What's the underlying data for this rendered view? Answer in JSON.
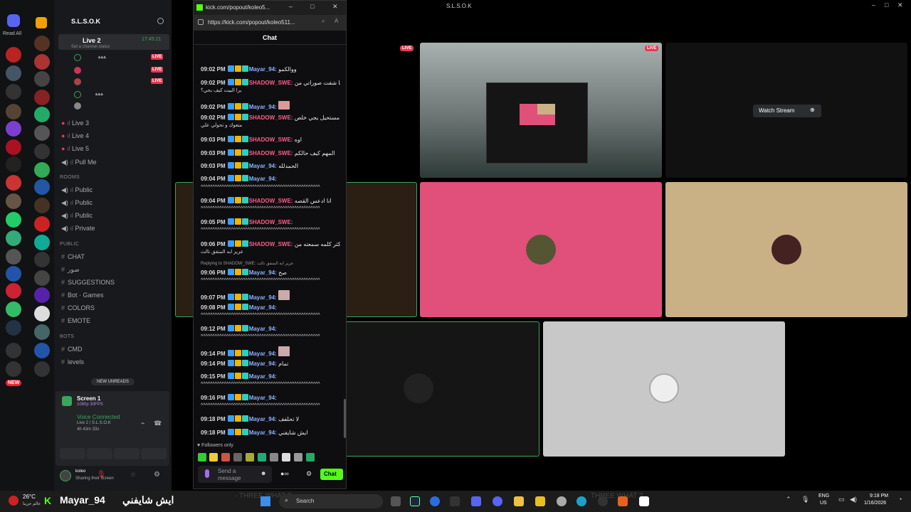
{
  "discord": {
    "read_all": "Read All",
    "new_label": "NEW",
    "server_name": "S.L.S.O.K",
    "live_channel": "Live 2",
    "live_time": "17:45:21",
    "set_status": "Set a channel status",
    "live_badge": "LIVE",
    "voice_users": [
      "ﻫﻫﻫ",
      "",
      "",
      "ﻫﻫﻫ",
      ""
    ],
    "channels_live": [
      "Live 3",
      "Live 4",
      "Live 5"
    ],
    "pull_me": "Pull Me",
    "rooms_label": "ROOMS",
    "rooms": [
      "Public",
      "Public",
      "Public",
      "Private"
    ],
    "public_label": "PUBLIC",
    "public_channels": [
      "CHAT",
      "صور",
      "SUGGESTIONS",
      "Bot · Games",
      "COLORS",
      "EMOTE"
    ],
    "bots_label": "BOTS",
    "bots_channels": [
      "CMD",
      "levels"
    ],
    "new_unreads": "NEW UNREADS",
    "screen_title": "Screen 1",
    "screen_sub": "1080p 30FPS",
    "voice_connected": "Voice Connected",
    "voice_channel": "Live 2 / S.L.S.O.K",
    "voice_time": "4h 43m 33s",
    "user_name": "koleo",
    "user_status": "Sharing their screen"
  },
  "window_title": "S.L.S.O.K",
  "stage": {
    "live_badge": "LIVE",
    "watch_stream": "Watch Stream"
  },
  "popout": {
    "title": "kick.com/popout/koleo5...",
    "url": "https://kick.com/popout/koleo511...",
    "header": "Chat",
    "messages": [
      {
        "time": "09:02 PM",
        "user": "Mayar_94:",
        "text": "ووالكمو"
      },
      {
        "time": "09:02 PM",
        "user": "SHADOW_SWE:",
        "text": "انا شفت صوراتي من"
      },
      {
        "time": "09:02 PM",
        "user": "Mayar_94:",
        "text": ""
      },
      {
        "time": "09:02 PM",
        "user": "SHADOW_SWE:",
        "text": "مستحيل يجي خلص"
      },
      {
        "time": "09:03 PM",
        "user": "SHADOW_SWE:",
        "text": "اوه"
      },
      {
        "time": "09:03 PM",
        "user": "SHADOW_SWE:",
        "text": "المهم كيف حالكم"
      },
      {
        "time": "09:03 PM",
        "user": "Mayar_94:",
        "text": "الحمدلله"
      },
      {
        "time": "09:04 PM",
        "user": "Mayar_94:",
        "text": ""
      },
      {
        "time": "09:04 PM",
        "user": "SHADOW_SWE:",
        "text": "انا ادعس القصه"
      },
      {
        "time": "09:05 PM",
        "user": "SHADOW_SWE:",
        "text": ""
      },
      {
        "time": "09:06 PM",
        "user": "SHADOW_SWE:",
        "text": "اكثر كلمه سمعته من"
      },
      {
        "time": "09:06 PM",
        "user": "Mayar_94:",
        "text": "صح"
      },
      {
        "time": "09:07 PM",
        "user": "Mayar_94:",
        "text": ""
      },
      {
        "time": "09:08 PM",
        "user": "Mayar_94:",
        "text": ""
      },
      {
        "time": "09:12 PM",
        "user": "Mayar_94:",
        "text": ""
      },
      {
        "time": "09:14 PM",
        "user": "Mayar_94:",
        "text": ""
      },
      {
        "time": "09:14 PM",
        "user": "Mayar_94:",
        "text": "تمام"
      },
      {
        "time": "09:15 PM",
        "user": "Mayar_94:",
        "text": ""
      },
      {
        "time": "09:16 PM",
        "user": "Mayar_94:",
        "text": ""
      },
      {
        "time": "09:18 PM",
        "user": "Mayar_94:",
        "text": "لا تحلفف"
      },
      {
        "time": "09:18 PM",
        "user": "Mayar_94:",
        "text": "ايش شايفني"
      }
    ],
    "continuation": "^^^^^^^^^^^^^^^^^^^^^^^^^^^^^^^^^^^^^^^^^^^^^^^^^^^",
    "line2_a": "برا البيت كيف بحي؟",
    "line2_b": "متعوك و تحولي علي",
    "line2_c": "عزيز ابه المتفق تالث",
    "reply_text": "Replying to SHADOW_SWE: عزيز ابه المتفق تالث",
    "followers_only": "Followers only",
    "send_placeholder": "Send a message",
    "chat_button": "Chat"
  },
  "taskbar": {
    "weather": "26°C",
    "weather_sub": "عالم حزينا",
    "notification_user": "Mayar_94",
    "notification_text": "ايش شايفني",
    "search": "Search",
    "lang": "ENG",
    "region": "US",
    "time": "9:18 PM",
    "date": "1/16/2026",
    "overlay_text_1": "- THREE WHAT ?",
    "overlay_text_2": "THREE WHAT ?"
  },
  "colors": {
    "pink_tile": "#e0507a",
    "tan_tile": "#c9b085",
    "gray_tile": "#c8c8c8",
    "kick_green": "#53fc18",
    "live_red": "#e8384f"
  }
}
